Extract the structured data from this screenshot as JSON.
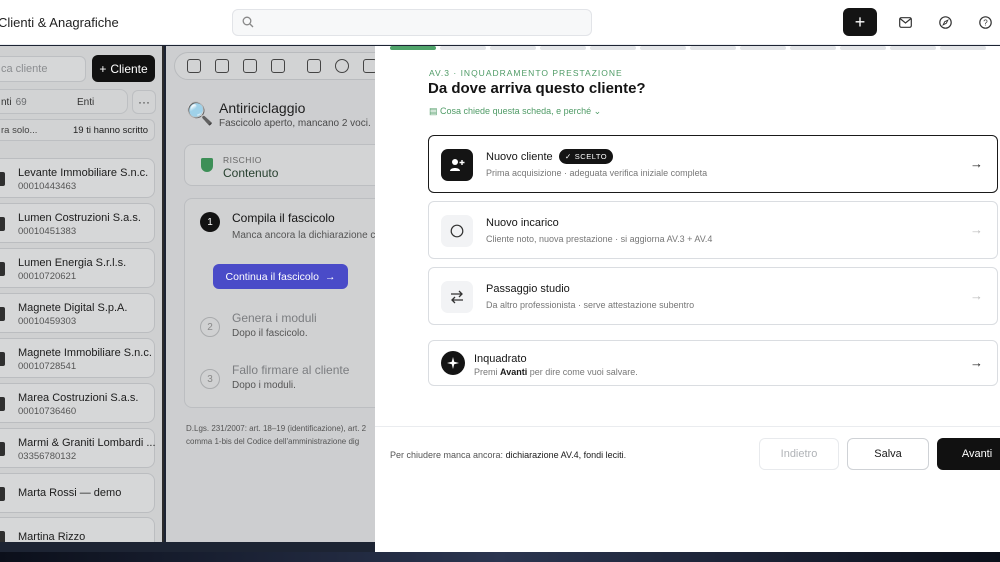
{
  "app": {
    "title": "Clienti & Anagrafiche"
  },
  "search": {
    "placeholder": ""
  },
  "topbar": {
    "new_label": "+"
  },
  "clients": {
    "search_placeholder": "ca cliente",
    "add_label": "Cliente",
    "tab_all_label": "nti",
    "tab_all_count": "69",
    "tab_entities_label": "Enti",
    "more_label": "···",
    "filter_label": "ra solo...",
    "filter_value": "19 ti hanno scritto",
    "items": [
      {
        "name": "Levante Immobiliare S.n.c.",
        "id": "00010443463"
      },
      {
        "name": "Lumen Costruzioni S.a.s.",
        "id": "00010451383"
      },
      {
        "name": "Lumen Energia S.r.l.s.",
        "id": "00010720621"
      },
      {
        "name": "Magnete Digital S.p.A.",
        "id": "00010459303"
      },
      {
        "name": "Magnete Immobiliare S.n.c.",
        "id": "00010728541"
      },
      {
        "name": "Marea Costruzioni S.a.s.",
        "id": "00010736460"
      },
      {
        "name": "Marmi & Graniti Lombardi ...",
        "id": "03356780132"
      },
      {
        "name": "Marta Rossi — demo",
        "id": ""
      },
      {
        "name": "Martina Rizzo",
        "id": ""
      }
    ]
  },
  "case": {
    "title": "Antiriciclaggio",
    "subtitle": "Fascicolo aperto, mancano 2 voci.",
    "risk_label": "RISCHIO",
    "risk_value": "Contenuto",
    "steps": [
      {
        "num": "1",
        "title": "Compila il fascicolo",
        "desc": "Manca ancora la dichiarazione c"
      },
      {
        "num": "2",
        "title": "Genera i moduli",
        "desc": "Dopo il fascicolo."
      },
      {
        "num": "3",
        "title": "Fallo firmare al cliente",
        "desc": "Dopo i moduli."
      }
    ],
    "cta_label": "Continua il fascicolo",
    "footnote_1": "D.Lgs. 231/2007: art. 18–19 (identificazione), art. 2",
    "footnote_2": "comma 1-bis del Codice dell'amministrazione dig"
  },
  "wizard": {
    "progress": {
      "done": 1,
      "total": 12
    },
    "kicker": "AV.3 · INQUADRAMENTO PRESTAZIONE",
    "title": "Da dove arriva questo cliente?",
    "help_link": "Cosa chiede questa scheda, e perché",
    "options": [
      {
        "title": "Nuovo cliente",
        "badge": "SCELTO",
        "desc": "Prima acquisizione · adeguata verifica iniziale completa",
        "icon": "user-plus-icon",
        "selected": true
      },
      {
        "title": "Nuovo incarico",
        "desc": "Cliente noto, nuova prestazione · si aggiorna AV.3 + AV.4",
        "icon": "circle-icon",
        "selected": false
      },
      {
        "title": "Passaggio studio",
        "desc": "Da altro professionista · serve attestazione subentro",
        "icon": "swap-arrows-icon",
        "selected": false
      }
    ],
    "framed": {
      "title": "Inquadrato",
      "desc_prefix": "Premi",
      "desc_key": "Avanti",
      "desc_suffix": "per dire come vuoi salvare."
    },
    "missing_prefix": "Per chiudere manca ancora:",
    "missing_value": "dichiarazione AV.4, fondi leciti",
    "missing_suffix": ".",
    "back_label": "Indietro",
    "save_label": "Salva",
    "next_label": "Avanti"
  },
  "colors": {
    "accent_green": "#4fa36a",
    "cta_blue": "#4a4bc8",
    "dark": "#141414"
  }
}
